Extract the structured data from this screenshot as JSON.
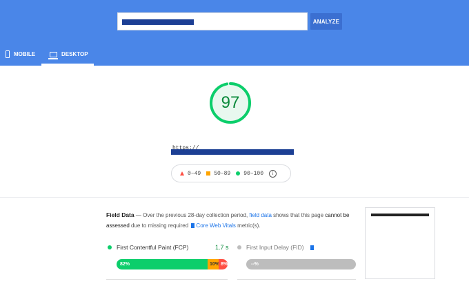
{
  "header": {
    "url_input_value": "",
    "analyze_label": "ANALYZE",
    "tabs": [
      {
        "label": "MOBILE",
        "active": false
      },
      {
        "label": "DESKTOP",
        "active": true
      }
    ]
  },
  "score": {
    "value": "97",
    "fraction": 0.97,
    "color": "#0cce6b",
    "tested_url_prefix": "https://"
  },
  "legend": {
    "poor": "0–49",
    "average": "50–89",
    "good": "90–100",
    "info_icon": "info-icon"
  },
  "field_data": {
    "title": "Field Data",
    "dash": "—",
    "text_1": "Over the previous 28-day collection period,",
    "link_1": "field data",
    "text_2": "shows that this page",
    "text_3": "cannot be assessed",
    "text_4": "due to missing required",
    "link_2": "Core Web Vitals",
    "text_5": "metric(s).",
    "metrics": [
      {
        "name": "First Contentful Paint (FCP)",
        "value": "1.7 s",
        "good": "82%",
        "average": "10%",
        "poor": "8%",
        "good_frac": 0.82,
        "average_frac": 0.1,
        "poor_frac": 0.08
      },
      {
        "name": "First Input Delay (FID)",
        "value": "",
        "bar_text": "--%"
      }
    ]
  },
  "colors": {
    "header": "#4a86e8",
    "good": "#0cce6b",
    "average": "#ffa400",
    "poor": "#ff4e42"
  }
}
